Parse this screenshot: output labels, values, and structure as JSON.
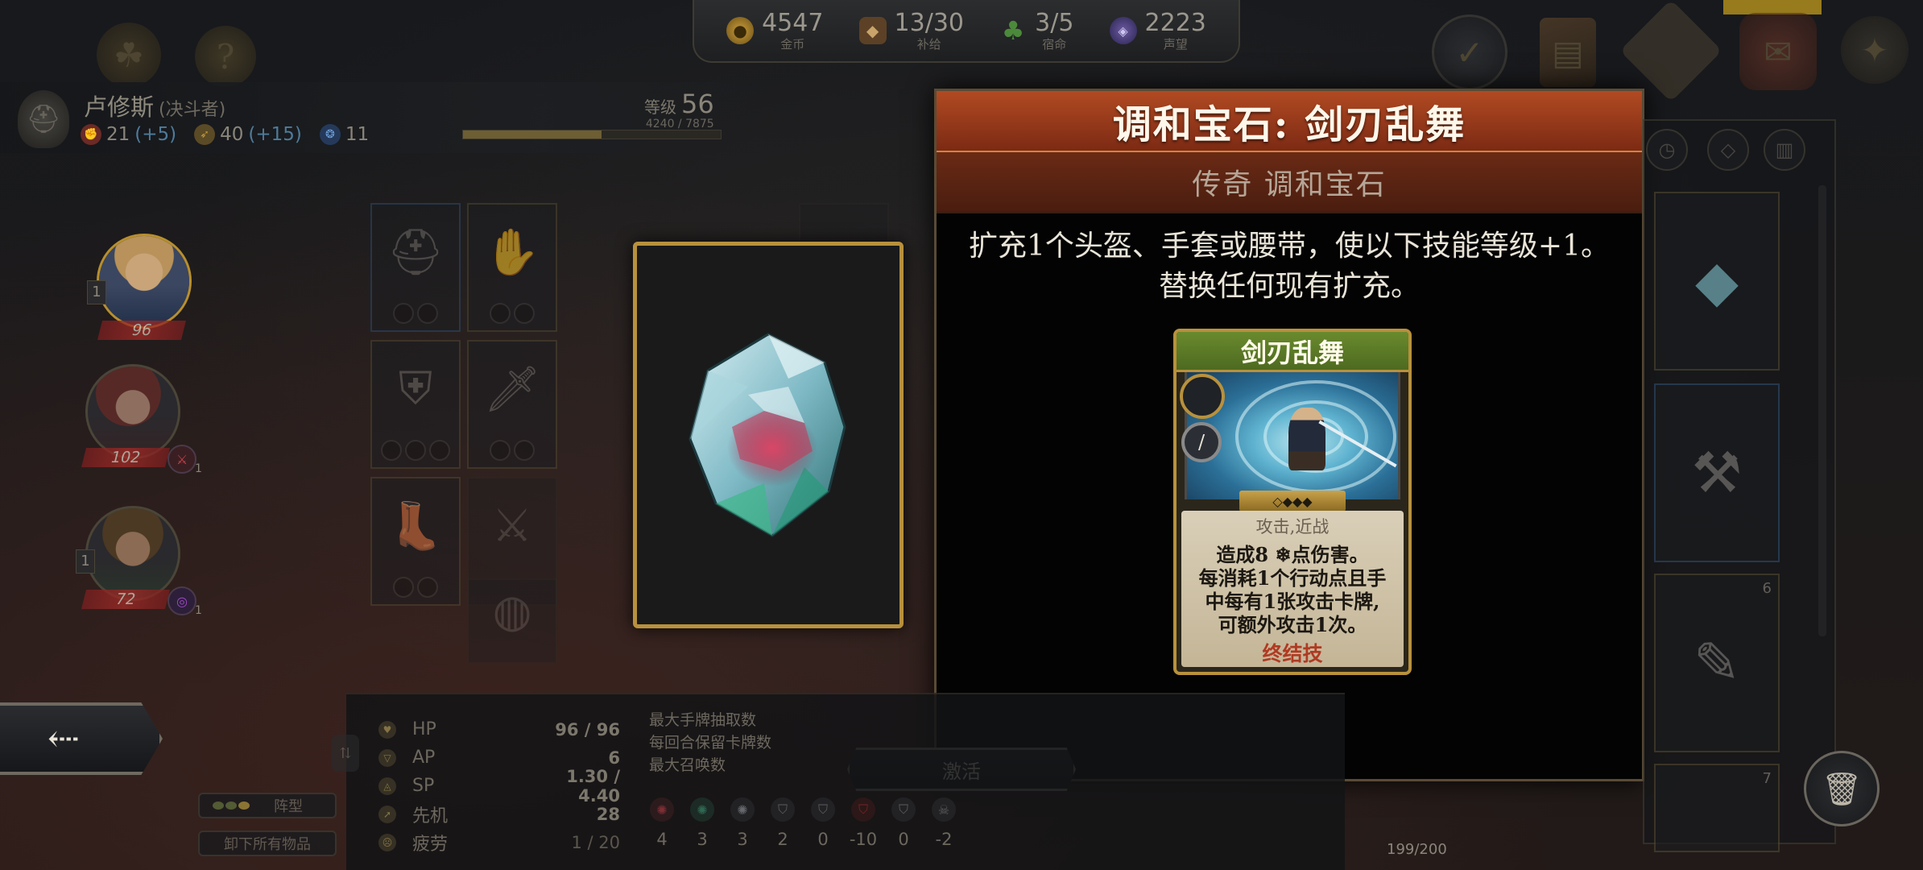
{
  "resources": {
    "gold": {
      "value": "4547",
      "label": "金币",
      "icon": "coin-icon"
    },
    "supply": {
      "value": "13/30",
      "label": "补给",
      "icon": "supply-bag-icon"
    },
    "fate": {
      "value": "3/5",
      "label": "宿命",
      "icon": "clover-icon"
    },
    "fame": {
      "value": "2223",
      "label": "声望",
      "icon": "fame-gem-icon"
    }
  },
  "hero": {
    "name": "卢修斯",
    "class": "(决斗者)",
    "strength": "21",
    "strength_bonus": "(+5)",
    "agility": "40",
    "agility_bonus": "(+15)",
    "intellect": "11",
    "level_label": "等级",
    "level": "56",
    "xp": "4240 / 7875",
    "xp_fraction": 0.538
  },
  "party": [
    {
      "hp": "96",
      "level": "1",
      "active": true
    },
    {
      "hp": "102",
      "buff_count": "1"
    },
    {
      "hp": "72",
      "level": "1",
      "buff_count": "1"
    }
  ],
  "tooltip": {
    "title": "调和宝石: 剑刃乱舞",
    "rarity_type": "传奇 调和宝石",
    "description_line1": "扩充1个头盔、手套或腰带，使以下技能等级+1。",
    "description_line2": "替换任何现有扩充。",
    "skill_card": {
      "name": "剑刃乱舞",
      "type": "攻击,近战",
      "effect_lines": [
        "造成8 ❄点伤害。",
        "每消耗1个行动点且手",
        "中每有1张攻击卡牌,",
        "可额外攻击1次。"
      ],
      "keyword": "终结技"
    }
  },
  "activate_button": "激活",
  "stats": [
    {
      "label": "HP",
      "value": "96 / 96",
      "icon": "heart-icon"
    },
    {
      "label": "AP",
      "value": "6",
      "icon": "ap-icon"
    },
    {
      "label": "SP",
      "value": "1.30 / 4.40",
      "icon": "sp-icon"
    },
    {
      "label": "先机",
      "value": "28",
      "icon": "initiative-icon"
    },
    {
      "label": "疲劳",
      "value": "1 / 20",
      "icon": "fatigue-icon",
      "muted": true
    }
  ],
  "extra_stats": [
    "最大手牌抽取数",
    "每回合保留卡牌数",
    "最大召唤数"
  ],
  "resistances": [
    {
      "icon": "red-swirl-icon",
      "value": "4",
      "color": "#c2404a"
    },
    {
      "icon": "green-swirl-icon",
      "value": "3",
      "color": "#3fa07a"
    },
    {
      "icon": "white-swirl-icon",
      "value": "3",
      "color": "#9aa0a8"
    },
    {
      "icon": "shield-icon",
      "value": "2",
      "color": "#8a8a8a"
    },
    {
      "icon": "shield-icon",
      "value": "0",
      "color": "#8a8a8a"
    },
    {
      "icon": "red-shield-icon",
      "value": "-10",
      "color": "#b03030"
    },
    {
      "icon": "shield-icon",
      "value": "0",
      "color": "#8a8a8a"
    },
    {
      "icon": "skull-shield-icon",
      "value": "-2",
      "color": "#8a8a8a"
    }
  ],
  "inventory": {
    "capacity": "199/200",
    "slot_counts": [
      "6",
      "7"
    ]
  },
  "buttons": {
    "formation": "阵型",
    "unequip_all": "卸下所有物品"
  }
}
